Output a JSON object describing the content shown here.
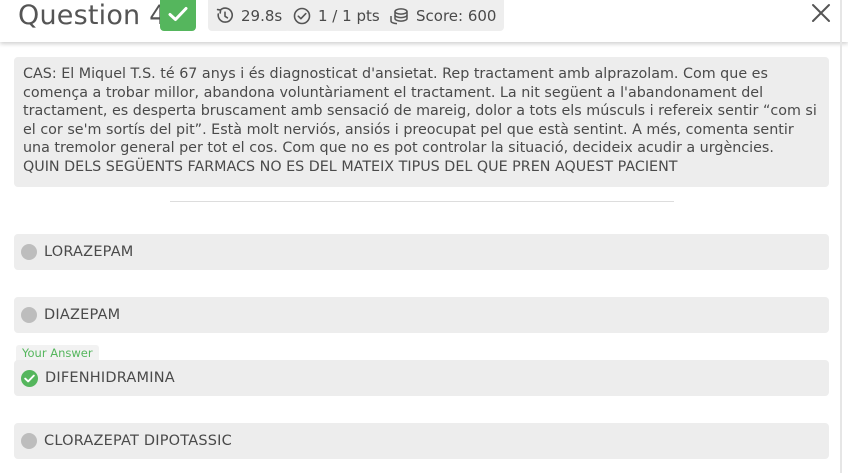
{
  "header": {
    "title": "Question 4",
    "time": "29.8s",
    "points": "1 / 1 pts",
    "score": "Score: 600"
  },
  "question": {
    "text": "CAS: El Miquel T.S. té 67 anys i és diagnosticat d'ansietat. Rep tractament amb alprazolam. Com que es comença a trobar millor, abandona voluntàriament el tractament. La nit següent a l'abandonament del tractament, es desperta bruscament amb sensació de mareig, dolor a tots els músculs i refereix sentir “com si el cor se'm sortís del pit”. Està molt nerviós, ansiós i preocupat pel que està sentint. A més, comenta sentir una tremolor general per tot el cos. Com que no es pot controlar la situació, decideix acudir a urgències.",
    "prompt": "QUIN DELS SEGÜENTS FARMACS NO ES DEL MATEIX TIPUS DEL QUE PREN AQUEST PACIENT"
  },
  "your_answer_label": "Your Answer",
  "options": [
    {
      "label": "LORAZEPAM"
    },
    {
      "label": "DIAZEPAM"
    },
    {
      "label": "DIFENHIDRAMINA"
    },
    {
      "label": "CLORAZEPAT DIPOTASSIC"
    }
  ],
  "colors": {
    "correct": "#55b65d",
    "panel_bg": "#ededed",
    "radio_idle": "#bdbdbd"
  },
  "icons": {
    "correct": "check-icon",
    "timer": "timer-icon",
    "points": "check-circle-icon",
    "score": "coins-icon",
    "close": "close-icon"
  }
}
